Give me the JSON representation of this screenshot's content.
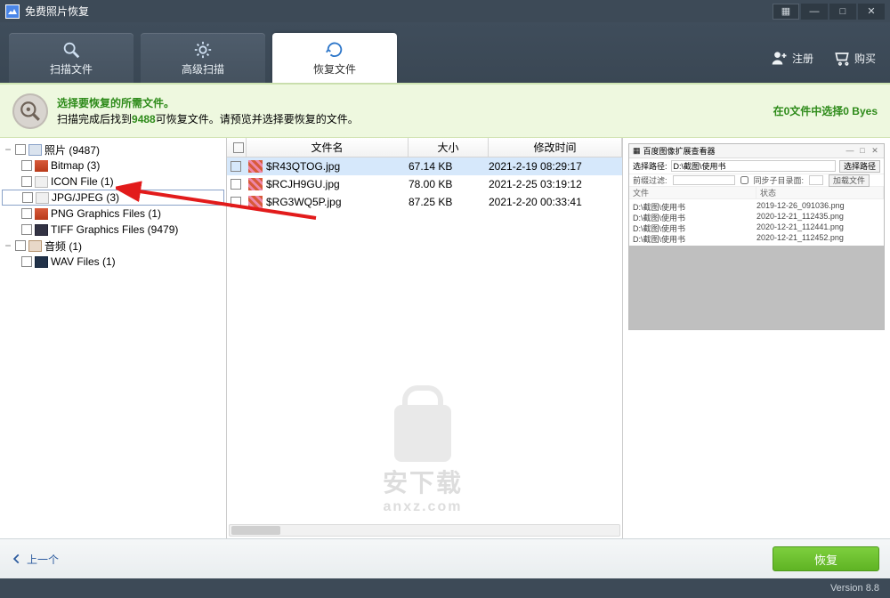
{
  "app": {
    "title": "免费照片恢复"
  },
  "window": {
    "menu": "▦",
    "min": "—",
    "max": "□",
    "close": "✕"
  },
  "header": {
    "tabs": [
      {
        "label": "扫描文件"
      },
      {
        "label": "高级扫描"
      },
      {
        "label": "恢复文件"
      }
    ],
    "register": "注册",
    "buy": "购买"
  },
  "instruct": {
    "line1": "选择要恢复的所需文件。",
    "line2a": "扫描完成后找到",
    "count": "9488",
    "line2b": "可恢复文件。请预览并选择要恢复的文件。",
    "right": "在0文件中选择0 Byes"
  },
  "tree": {
    "photos": {
      "label": "照片 (9487)"
    },
    "bitmap": {
      "label": "Bitmap (3)"
    },
    "icon": {
      "label": "ICON File (1)"
    },
    "jpg": {
      "label": "JPG/JPEG (3)"
    },
    "png": {
      "label": "PNG Graphics Files (1)"
    },
    "tiff": {
      "label": "TIFF Graphics Files (9479)"
    },
    "audio": {
      "label": "音频 (1)"
    },
    "wav": {
      "label": "WAV Files (1)"
    }
  },
  "cols": {
    "name": "文件名",
    "size": "大小",
    "date": "修改时间"
  },
  "files": [
    {
      "name": "$R43QTOG.jpg",
      "size": "67.14 KB",
      "date": "2021-2-19 08:29:17"
    },
    {
      "name": "$RCJH9GU.jpg",
      "size": "78.00 KB",
      "date": "2021-2-25 03:19:12"
    },
    {
      "name": "$RG3WQ5P.jpg",
      "size": "87.25 KB",
      "date": "2021-2-20 00:33:41"
    }
  ],
  "preview": {
    "title": "百度图像扩展查看器",
    "pathLabel": "选择路径:",
    "path": "D:\\截图\\使用书",
    "browse": "选择路径",
    "filterLabel": "前缀过滤:",
    "subdirs": "同步子目录面:",
    "loadBtn": "加载文件",
    "col1": "文件",
    "col2": "状态",
    "list": [
      {
        "n": "D:\\截图\\使用书",
        "f": "2019-12-26_091036.png"
      },
      {
        "n": "D:\\截图\\使用书",
        "f": "2020-12-21_112435.png"
      },
      {
        "n": "D:\\截图\\使用书",
        "f": "2020-12-21_112441.png"
      },
      {
        "n": "D:\\截图\\使用书",
        "f": "2020-12-21_112452.png"
      }
    ]
  },
  "watermark": {
    "t1": "安下载",
    "t2": "anxz.com"
  },
  "footer": {
    "prev": "上一个",
    "recover": "恢复"
  },
  "version": "Version 8.8"
}
